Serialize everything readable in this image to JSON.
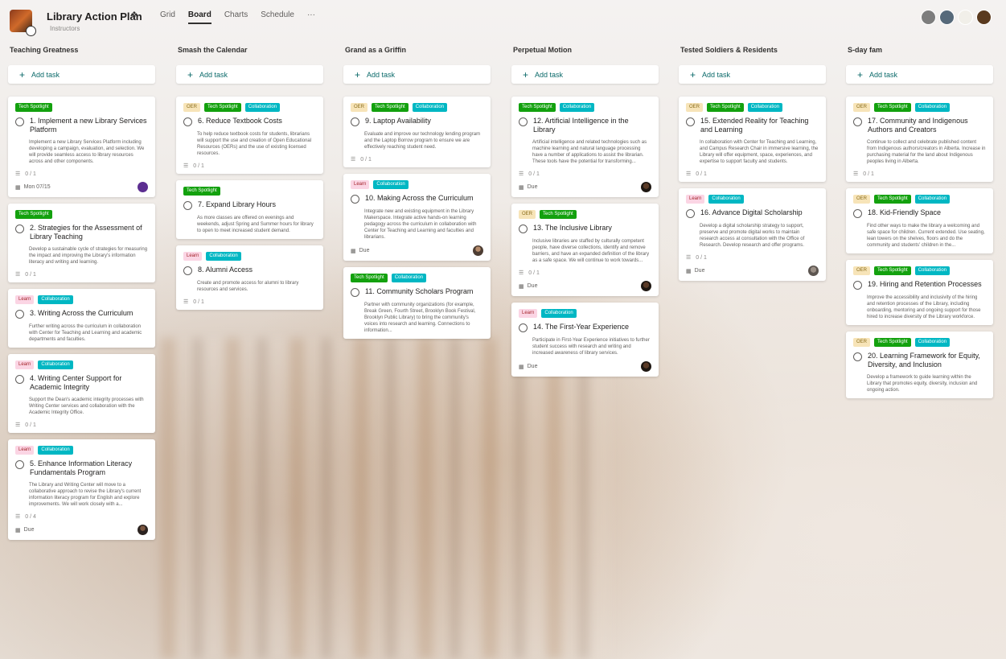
{
  "header": {
    "plan_title": "Library Action Plan",
    "plan_subtitle": "Instructors",
    "tabs": [
      "Grid",
      "Board",
      "Charts",
      "Schedule"
    ],
    "more_label": "···",
    "active_tab": "Board",
    "avatar_colors": [
      "#7d7d7d",
      "#56697a",
      "#f1efe9",
      "#5a3a1e"
    ]
  },
  "add_task_label": "Add task",
  "buckets": [
    {
      "name": "Teaching Greatness",
      "cards": [
        {
          "labels": [
            {
              "text": "Tech Spotlight",
              "color": "green"
            }
          ],
          "title": "1. Implement a new Library Services Platform",
          "description": "Implement a new Library Services Platform including developing a campaign, evaluation, and selection. We will provide seamless access to library resources across and other components.",
          "meta": "0 / 1",
          "due": "Mon 07/15",
          "assignee": "purple"
        },
        {
          "labels": [
            {
              "text": "Tech Spotlight",
              "color": "green"
            }
          ],
          "title": "2. Strategies for the Assessment of Library Teaching",
          "description": "Develop a sustainable cycle of strategies for measuring the impact and improving the Library's information literacy and writing and learning.",
          "meta": "0 / 1",
          "due": "",
          "assignee": ""
        },
        {
          "labels": [
            {
              "text": "Learn",
              "color": "pink"
            },
            {
              "text": "Collaboration",
              "color": "teal"
            }
          ],
          "title": "3. Writing Across the Curriculum",
          "description": "Further writing across the curriculum in collaboration with Center for Teaching and Learning and academic departments and faculties.",
          "meta": "",
          "due": "",
          "assignee": ""
        },
        {
          "labels": [
            {
              "text": "Learn",
              "color": "pink"
            },
            {
              "text": "Collaboration",
              "color": "teal"
            }
          ],
          "title": "4. Writing Center Support for Academic Integrity",
          "description": "Support the Dean's academic integrity processes with Writing Center services and collaboration with the Academic Integrity Office.",
          "meta": "0 / 1",
          "due": "",
          "assignee": ""
        },
        {
          "labels": [
            {
              "text": "Learn",
              "color": "pink"
            },
            {
              "text": "Collaboration",
              "color": "teal"
            }
          ],
          "title": "5. Enhance Information Literacy Fundamentals Program",
          "description": "The Library and Writing Center will move to a collaborative approach to revise the Library's current information literacy program for English and explore improvements. We will work closely with a...",
          "meta": "0 / 4",
          "due": "Due",
          "assignee": "photo1"
        }
      ]
    },
    {
      "name": "Smash the Calendar",
      "cards": [
        {
          "labels": [
            {
              "text": "OER",
              "color": "tan"
            },
            {
              "text": "Tech Spotlight",
              "color": "green"
            },
            {
              "text": "Collaboration",
              "color": "teal"
            }
          ],
          "title": "6. Reduce Textbook Costs",
          "description": "To help reduce textbook costs for students, librarians will support the use and creation of Open Educational Resources (OERs) and the use of existing licensed resources.",
          "meta": "0 / 1",
          "due": "",
          "assignee": ""
        },
        {
          "labels": [
            {
              "text": "Tech Spotlight",
              "color": "green"
            }
          ],
          "title": "7. Expand Library Hours",
          "description": "As more classes are offered on evenings and weekends, adjust Spring and Summer hours for library to open to meet increased student demand.",
          "meta": "",
          "due": "",
          "assignee": ""
        },
        {
          "labels": [
            {
              "text": "Learn",
              "color": "pink"
            },
            {
              "text": "Collaboration",
              "color": "teal"
            }
          ],
          "title": "8. Alumni Access",
          "description": "Create and promote access for alumni to library resources and services.",
          "meta": "0 / 1",
          "due": "",
          "assignee": ""
        }
      ]
    },
    {
      "name": "Grand as a Griffin",
      "cards": [
        {
          "labels": [
            {
              "text": "OER",
              "color": "tan"
            },
            {
              "text": "Tech Spotlight",
              "color": "green"
            },
            {
              "text": "Collaboration",
              "color": "teal"
            }
          ],
          "title": "9. Laptop Availability",
          "description": "Evaluate and improve our technology lending program and the Laptop Borrow program to ensure we are effectively reaching student need.",
          "meta": "0 / 1",
          "due": "",
          "assignee": ""
        },
        {
          "labels": [
            {
              "text": "Learn",
              "color": "pink"
            },
            {
              "text": "Collaboration",
              "color": "teal"
            }
          ],
          "title": "10. Making Across the Curriculum",
          "description": "Integrate new and existing equipment in the Library Makerspace. Integrate active hands-on learning pedagogy across the curriculum in collaboration with Center for Teaching and Learning and faculties and librarians.",
          "meta": "",
          "due": "Due",
          "assignee": "photo2"
        },
        {
          "labels": [
            {
              "text": "Tech Spotlight",
              "color": "green"
            },
            {
              "text": "Collaboration",
              "color": "teal"
            }
          ],
          "title": "11. Community Scholars Program",
          "description": "Partner with community organizations (for example, Break Green, Fourth Street, Brooklyn Book Festival, Brooklyn Public Library) to bring the community's voices into research and learning. Connections to information...",
          "meta": "",
          "due": "",
          "assignee": ""
        }
      ]
    },
    {
      "name": "Perpetual Motion",
      "cards": [
        {
          "labels": [
            {
              "text": "Tech Spotlight",
              "color": "green"
            },
            {
              "text": "Collaboration",
              "color": "teal"
            }
          ],
          "title": "12. Artificial Intelligence in the Library",
          "description": "Artificial intelligence and related technologies such as machine learning and natural language processing have a number of applications to assist the librarian. These tools have the potential for transforming...",
          "meta": "0 / 1",
          "due": "Due",
          "assignee": "photo3"
        },
        {
          "labels": [
            {
              "text": "OER",
              "color": "tan"
            },
            {
              "text": "Tech Spotlight",
              "color": "green"
            }
          ],
          "title": "13. The Inclusive Library",
          "description": "Inclusive libraries are staffed by culturally competent people, have diverse collections, identify and remove barriers, and have an expanded definition of the library as a safe space. We will continue to work towards...",
          "meta": "0 / 1",
          "due": "Due",
          "assignee": "photo3"
        },
        {
          "labels": [
            {
              "text": "Learn",
              "color": "pink"
            },
            {
              "text": "Collaboration",
              "color": "teal"
            }
          ],
          "title": "14. The First-Year Experience",
          "description": "Participate in First-Year Experience initiatives to further student success with research and writing and increased awareness of library services.",
          "meta": "",
          "due": "Due",
          "assignee": "photo3"
        }
      ]
    },
    {
      "name": "Tested Soldiers & Residents",
      "cards": [
        {
          "labels": [
            {
              "text": "OER",
              "color": "tan"
            },
            {
              "text": "Tech Spotlight",
              "color": "green"
            },
            {
              "text": "Collaboration",
              "color": "teal"
            }
          ],
          "title": "15. Extended Reality for Teaching and Learning",
          "description": "In collaboration with Center for Teaching and Learning, and Campus Research Chair in immersive learning, the Library will offer equipment, space, experiences, and expertise to support faculty and students.",
          "meta": "0 / 1",
          "due": "",
          "assignee": ""
        },
        {
          "labels": [
            {
              "text": "Learn",
              "color": "pink"
            },
            {
              "text": "Collaboration",
              "color": "teal"
            }
          ],
          "title": "16. Advance Digital Scholarship",
          "description": "Develop a digital scholarship strategy to support, preserve and promote digital works to maintain research access at consultation with the Office of Research. Develop research and offer programs.",
          "meta": "0 / 1",
          "due": "Due",
          "assignee": "photo4"
        }
      ]
    },
    {
      "name": "S-day fam",
      "cards": [
        {
          "labels": [
            {
              "text": "OER",
              "color": "tan"
            },
            {
              "text": "Tech Spotlight",
              "color": "green"
            },
            {
              "text": "Collaboration",
              "color": "teal"
            }
          ],
          "title": "17. Community and Indigenous Authors and Creators",
          "description": "Continue to collect and celebrate published content from Indigenous authors/creators in Alberta. Increase in purchasing material for the land about Indigenous peoples living in Alberta.",
          "meta": "0 / 1",
          "due": "",
          "assignee": ""
        },
        {
          "labels": [
            {
              "text": "OER",
              "color": "tan"
            },
            {
              "text": "Tech Spotlight",
              "color": "green"
            },
            {
              "text": "Collaboration",
              "color": "teal"
            }
          ],
          "title": "18. Kid-Friendly Space",
          "description": "Find other ways to make the library a welcoming and safe space for children. Current extended. Use seating, lean towers on the shelves, floors and do the community and students' children in the...",
          "meta": "",
          "due": "",
          "assignee": ""
        },
        {
          "labels": [
            {
              "text": "OER",
              "color": "tan"
            },
            {
              "text": "Tech Spotlight",
              "color": "green"
            },
            {
              "text": "Collaboration",
              "color": "teal"
            }
          ],
          "title": "19. Hiring and Retention Processes",
          "description": "Improve the accessibility and inclusivity of the hiring and retention processes of the Library, including onboarding, mentoring and ongoing support for those hired to increase diversity of the Library workforce.",
          "meta": "",
          "due": "",
          "assignee": ""
        },
        {
          "labels": [
            {
              "text": "OER",
              "color": "tan"
            },
            {
              "text": "Tech Spotlight",
              "color": "green"
            },
            {
              "text": "Collaboration",
              "color": "teal"
            }
          ],
          "title": "20. Learning Framework for Equity, Diversity, and Inclusion",
          "description": "Develop a framework to guide learning within the Library that promotes equity, diversity, inclusion and ongoing action.",
          "meta": "",
          "due": "",
          "assignee": ""
        }
      ]
    }
  ]
}
